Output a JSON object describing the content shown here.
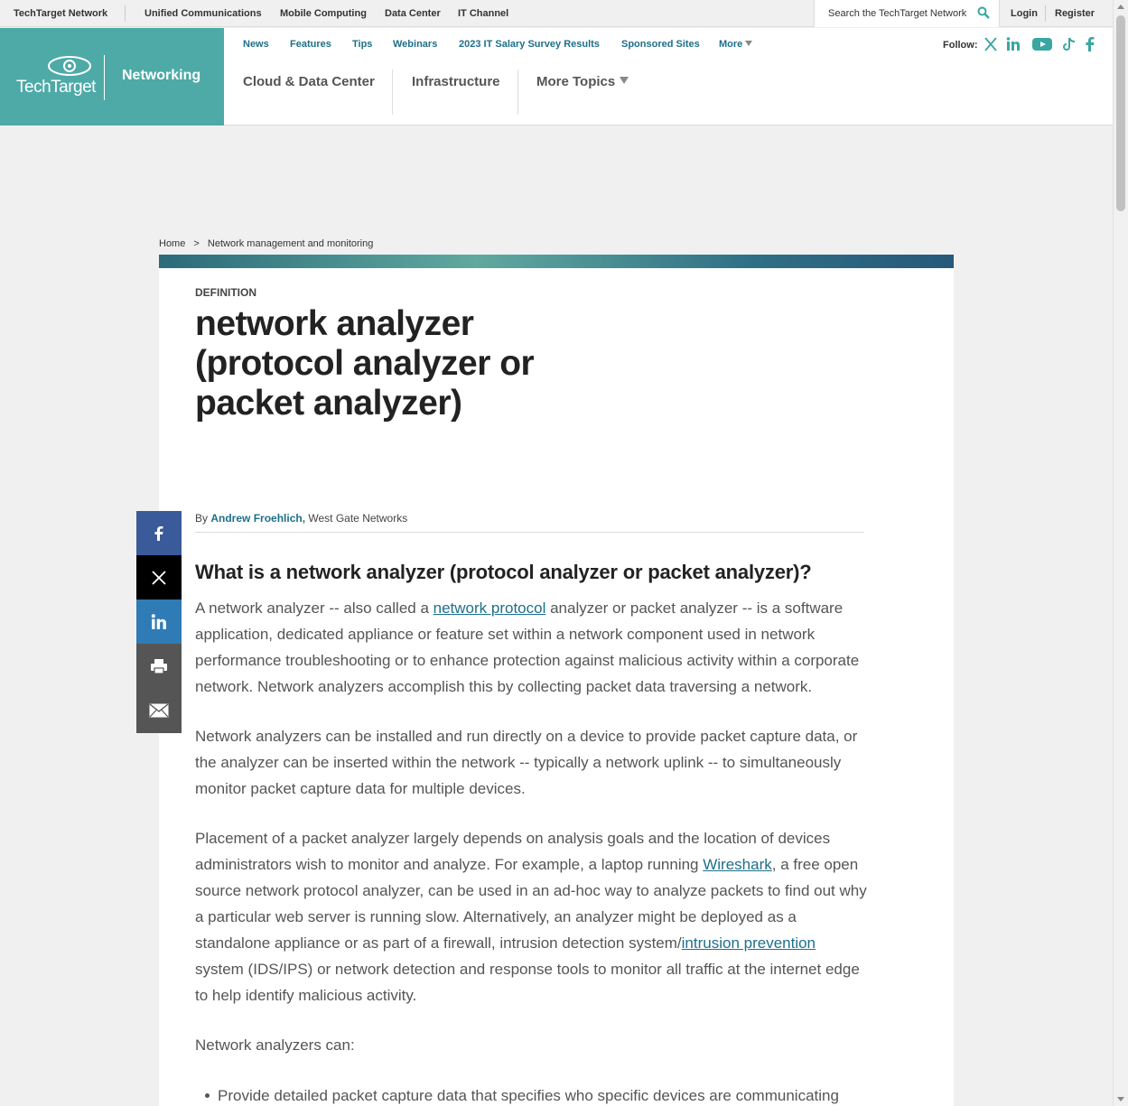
{
  "topbar": {
    "network": "TechTarget Network",
    "links": [
      "Unified Communications",
      "Mobile Computing",
      "Data Center",
      "IT Channel"
    ],
    "search_placeholder": "Search the TechTarget Network",
    "login": "Login",
    "register": "Register"
  },
  "brand": {
    "logo_text": "TechTarget",
    "section": "Networking",
    "color": "#4daaa7"
  },
  "subnav": [
    "News",
    "Features",
    "Tips",
    "Webinars",
    "2023 IT Salary Survey Results",
    "Sponsored Sites",
    "More"
  ],
  "follow": {
    "label": "Follow:",
    "icons": [
      "x-icon",
      "linkedin-icon",
      "youtube-icon",
      "tiktok-icon",
      "facebook-icon"
    ]
  },
  "mainnav": [
    "Cloud & Data Center",
    "Infrastructure",
    "More Topics"
  ],
  "breadcrumb": {
    "home": "Home",
    "sep": ">",
    "current": "Network management and monitoring"
  },
  "article": {
    "kicker": "DEFINITION",
    "title": "network analyzer (protocol analyzer or packet analyzer)",
    "byline_prefix": "By",
    "author": "Andrew Froehlich,",
    "org": "West Gate Networks",
    "heading": "What is a network analyzer (protocol analyzer or packet analyzer)?",
    "p1_a": "A network analyzer -- also called a ",
    "p1_link": "network protocol",
    "p1_b": " analyzer or packet analyzer -- is a software application, dedicated appliance or feature set within a network component used in network performance troubleshooting or to enhance protection against malicious activity within a corporate network. Network analyzers accomplish this by collecting packet data traversing a network.",
    "p2": "Network analyzers can be installed and run directly on a device to provide packet capture data, or the analyzer can be inserted within the network -- typically a network uplink -- to simultaneously monitor packet capture data for multiple devices.",
    "p3_a": "Placement of a packet analyzer largely depends on analysis goals and the location of devices administrators wish to monitor and analyze. For example, a laptop running ",
    "p3_link1": "Wireshark",
    "p3_b": ", a free open source network protocol analyzer, can be used in an ad-hoc way to analyze packets to find out why a particular web server is running slow. Alternatively, an analyzer might be deployed as a standalone appliance or as part of a firewall, intrusion detection system/",
    "p3_link2": "intrusion prevention",
    "p3_c": " system (IDS/IPS) or network detection and response tools to monitor all traffic at the internet edge to help identify malicious activity.",
    "p4": "Network analyzers can:",
    "bullet1": "Provide detailed packet capture data that specifies who specific devices are communicating"
  },
  "share": {
    "buttons": [
      {
        "icon": "facebook-icon",
        "color": "#3b5a9a"
      },
      {
        "icon": "x-icon",
        "color": "#000000"
      },
      {
        "icon": "linkedin-icon",
        "color": "#2f7bb5"
      },
      {
        "icon": "print-icon",
        "color": "#555555"
      },
      {
        "icon": "email-icon",
        "color": "#555555"
      }
    ]
  }
}
